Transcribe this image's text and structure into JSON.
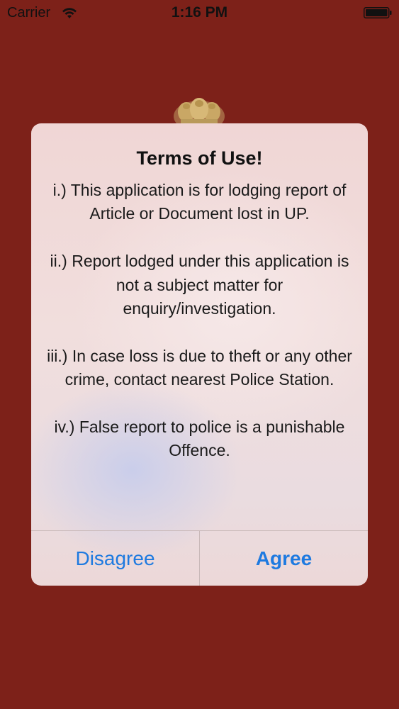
{
  "status_bar": {
    "carrier": "Carrier",
    "time": "1:16 PM",
    "wifi_icon": "wifi-icon",
    "battery_icon": "battery-full-icon"
  },
  "background": {
    "color": "#7d2119",
    "emblem_icon": "state-emblem-icon"
  },
  "dialog": {
    "title": "Terms of Use!",
    "terms": [
      "i.) This application is for lodging report of Article or Document lost in UP.",
      "ii.) Report lodged under this application is not a subject matter for enquiry/investigation.",
      "iii.) In case loss is due to theft or any other crime, contact nearest Police Station.",
      "iv.) False report to police is a punishable Offence."
    ],
    "buttons": {
      "disagree": "Disagree",
      "agree": "Agree"
    },
    "accent_color": "#1e7ae0"
  }
}
